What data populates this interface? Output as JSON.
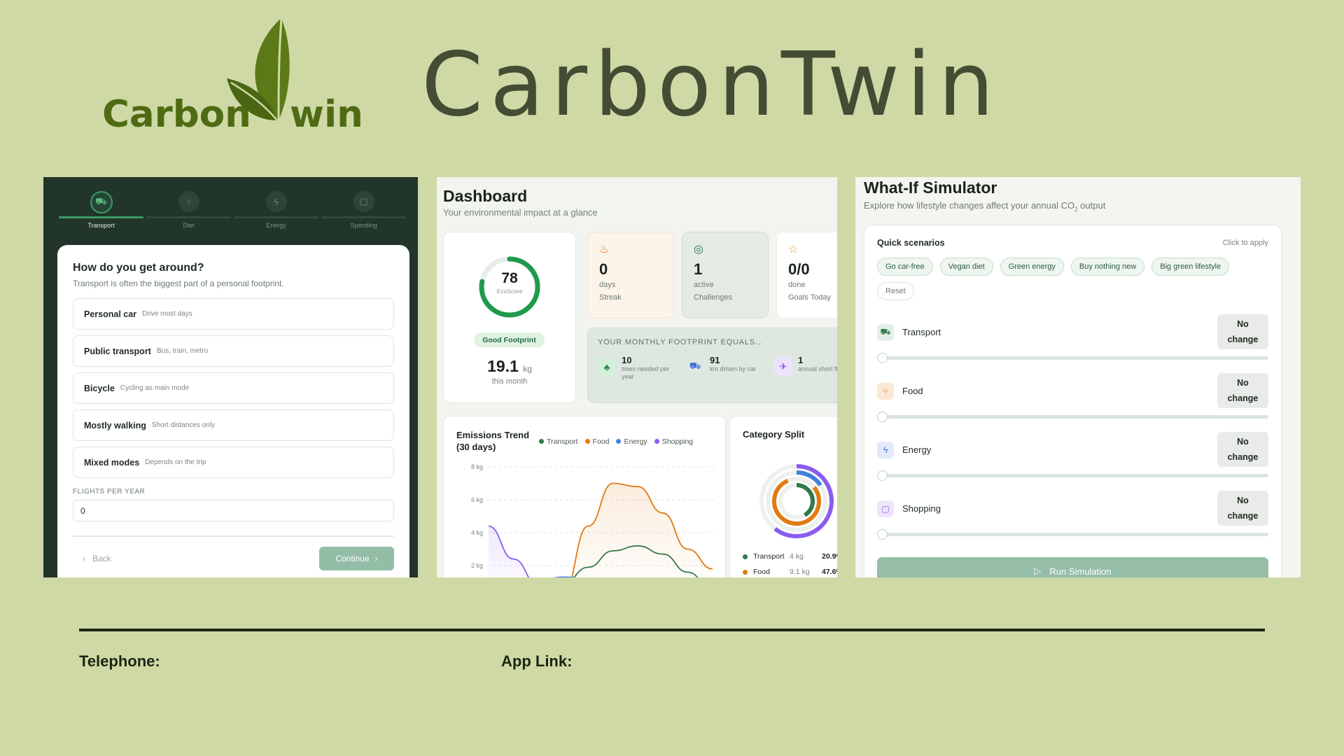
{
  "logo": {
    "left_text": "Carbon",
    "right_text": "win"
  },
  "brand_title": "CarbonTwin",
  "onboarding": {
    "steps": [
      {
        "label": "Transport",
        "icon": "car-icon",
        "active": true
      },
      {
        "label": "Diet",
        "icon": "utensils-icon",
        "active": false
      },
      {
        "label": "Energy",
        "icon": "bolt-icon",
        "active": false
      },
      {
        "label": "Spending",
        "icon": "bag-icon",
        "active": false
      }
    ],
    "question": "How do you get around?",
    "subtitle": "Transport is often the biggest part of a personal footprint.",
    "options": [
      {
        "main": "Personal car",
        "sub": "Drive most days"
      },
      {
        "main": "Public transport",
        "sub": "Bus, train, metro"
      },
      {
        "main": "Bicycle",
        "sub": "Cycling as main mode"
      },
      {
        "main": "Mostly walking",
        "sub": "Short distances only"
      },
      {
        "main": "Mixed modes",
        "sub": "Depends on the trip"
      }
    ],
    "flights_label": "FLIGHTS PER YEAR",
    "flights_value": "0",
    "back_label": "Back",
    "continue_label": "Continue"
  },
  "dashboard": {
    "title": "Dashboard",
    "subtitle": "Your environmental impact at a glance",
    "eco_score": 78,
    "eco_score_label": "EcoScore",
    "badge": "Good Footprint",
    "footprint_value": "19.1",
    "footprint_unit": "kg",
    "footprint_period": "this month",
    "stats": [
      {
        "value": "0",
        "line1": "days",
        "line2": "Streak",
        "icon": "flame-icon"
      },
      {
        "value": "1",
        "line1": "active",
        "line2": "Challenges",
        "icon": "target-icon"
      },
      {
        "value": "0/0",
        "line1": "done",
        "line2": "Goals Today",
        "icon": "star-icon"
      }
    ],
    "equals_title": "YOUR MONTHLY FOOTPRINT EQUALS...",
    "equals": [
      {
        "num": "10",
        "desc": "trees needed per year",
        "icon": "tree-icon"
      },
      {
        "num": "91",
        "desc": "km driven by car",
        "icon": "car-icon"
      },
      {
        "num": "1",
        "desc": "annual short flights",
        "icon": "plane-icon"
      }
    ],
    "colors": {
      "transport": "#2f7a4a",
      "food": "#e07b12",
      "energy": "#3f7fe0",
      "shopping": "#8a5cf0"
    }
  },
  "chart_data": [
    {
      "type": "line",
      "title": "Emissions Trend (30 days)",
      "ylabel": "",
      "ylim": [
        0,
        8
      ],
      "yticks": [
        "8 kg",
        "6 kg",
        "4 kg",
        "2 kg"
      ],
      "grid": true,
      "legend_position": "top-right",
      "series": [
        {
          "name": "Transport",
          "values": [
            0.0,
            0.0,
            0.3,
            0.9,
            1.9,
            2.9,
            3.2,
            2.7,
            1.6,
            0.5
          ]
        },
        {
          "name": "Food",
          "values": [
            0.0,
            0.0,
            0.0,
            0.4,
            4.4,
            7.0,
            6.8,
            5.2,
            3.0,
            1.8
          ]
        },
        {
          "name": "Energy",
          "values": [
            0.0,
            0.7,
            1.1,
            1.3,
            1.2,
            0.6,
            0.0,
            0.0,
            0.0,
            0.0
          ]
        },
        {
          "name": "Shopping",
          "values": [
            4.4,
            2.4,
            0.8,
            0.0,
            0.0,
            0.0,
            0.0,
            0.0,
            0.0,
            0.0
          ]
        }
      ]
    },
    {
      "type": "pie",
      "title": "Category Split",
      "series": [
        {
          "name": "Transport",
          "value_kg": "4 kg",
          "percent": 20.9
        },
        {
          "name": "Food",
          "value_kg": "9.1 kg",
          "percent": 47.6
        }
      ],
      "rows": [
        {
          "name": "Transport",
          "kg": "4 kg",
          "pct": "20.9%"
        },
        {
          "name": "Food",
          "kg": "9.1 kg",
          "pct": "47.6%"
        }
      ]
    }
  ],
  "simulator": {
    "title": "What-If Simulator",
    "subtitle_pre": "Explore how lifestyle changes affect your annual CO",
    "subtitle_sub": "2",
    "subtitle_post": " output",
    "quick_title": "Quick scenarios",
    "quick_hint": "Click to apply",
    "chips": [
      "Go car-free",
      "Vegan diet",
      "Green energy",
      "Buy nothing new",
      "Big green lifestyle"
    ],
    "reset_label": "Reset",
    "rows": [
      {
        "name": "Transport",
        "status_line1": "No",
        "status_line2": "change",
        "icon": "car-icon",
        "level": 0
      },
      {
        "name": "Food",
        "status_line1": "No",
        "status_line2": "change",
        "icon": "utensils-icon",
        "level": 0
      },
      {
        "name": "Energy",
        "status_line1": "No",
        "status_line2": "change",
        "icon": "bolt-icon",
        "level": 0
      },
      {
        "name": "Shopping",
        "status_line1": "No",
        "status_line2": "change",
        "icon": "bag-icon",
        "level": 0
      }
    ],
    "run_label": "Run Simulation"
  },
  "footer": {
    "telephone_label": "Telephone:",
    "app_link_label": "App Link:"
  }
}
